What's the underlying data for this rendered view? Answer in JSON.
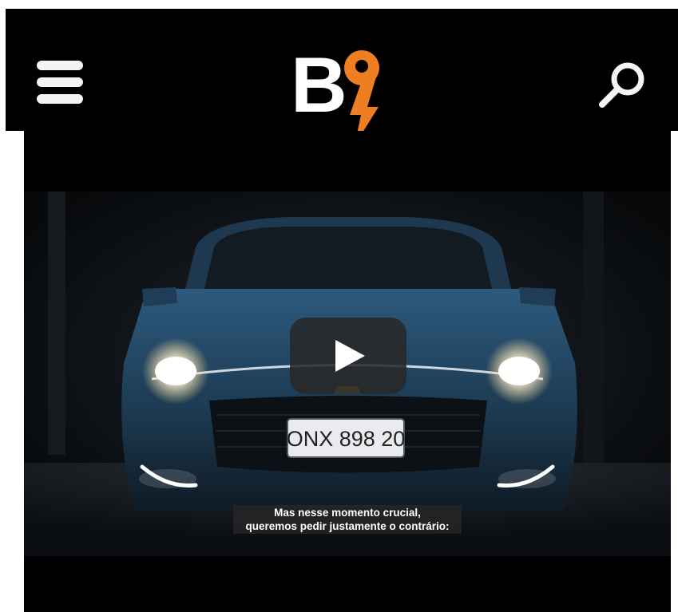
{
  "header": {
    "menu_icon": "hamburger-menu-icon",
    "logo_text": "B9",
    "search_icon": "search-icon"
  },
  "colors": {
    "header_bg": "#000000",
    "logo_white": "#ffffff",
    "logo_orange": "#ef7d22",
    "content_bg": "#000000"
  },
  "video": {
    "plate_text": "ONX 898 20",
    "play_icon": "play-icon",
    "subtitle_line1": "Mas nesse momento crucial,",
    "subtitle_line2": "queremos pedir justamente o contrário:"
  }
}
